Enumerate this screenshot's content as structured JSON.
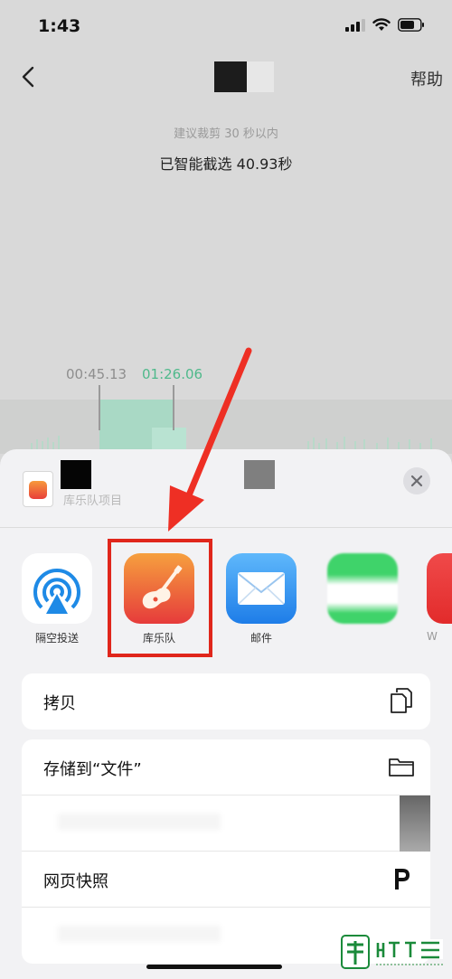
{
  "status_bar": {
    "time": "1:43"
  },
  "nav": {
    "help": "帮助"
  },
  "trim": {
    "hint": "建议裁剪 30 秒以内",
    "selected": "已智能截选 40.93秒",
    "start_time": "00:45.13",
    "end_time": "01:26.06"
  },
  "sheet": {
    "subtitle": "库乐队项目",
    "apps": [
      {
        "label": "隔空投送",
        "icon": "airdrop-icon"
      },
      {
        "label": "库乐队",
        "icon": "garageband-icon"
      },
      {
        "label": "邮件",
        "icon": "mail-icon"
      },
      {
        "label": "",
        "icon": "messages-icon"
      },
      {
        "label": "W",
        "icon": "app-icon"
      }
    ],
    "actions": [
      {
        "label": "拷贝",
        "icon": "copy-icon"
      },
      {
        "label": "存储到“文件”",
        "icon": "folder-icon"
      },
      {
        "label": "",
        "icon": "blurred-icon"
      },
      {
        "label": "网页快照",
        "icon": "p-icon"
      },
      {
        "label": "",
        "icon": "blurred-icon"
      }
    ]
  },
  "colors": {
    "accent_green": "#4fb98b",
    "highlight_red": "#e0261b",
    "mail_blue": "#2a8cf0",
    "airdrop_blue": "#1e8ae6"
  }
}
